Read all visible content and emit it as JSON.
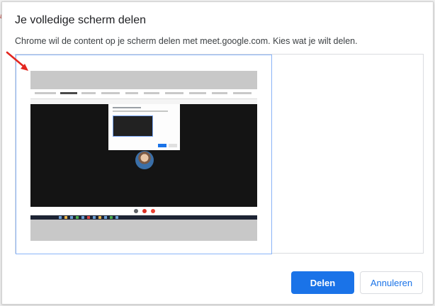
{
  "dialog": {
    "title": "Je volledige scherm delen",
    "subtitle": "Chrome wil de content op je scherm delen met meet.google.com. Kies wat je wilt delen.",
    "buttons": {
      "share_label": "Delen",
      "cancel_label": "Annuleren"
    }
  },
  "colors": {
    "primary": "#1a73e8",
    "selection_border": "#8ab4f8",
    "annotation_arrow": "#e3261f"
  },
  "icons": {
    "annotation": "red-arrow-icon",
    "preview": "screen-thumbnail"
  }
}
